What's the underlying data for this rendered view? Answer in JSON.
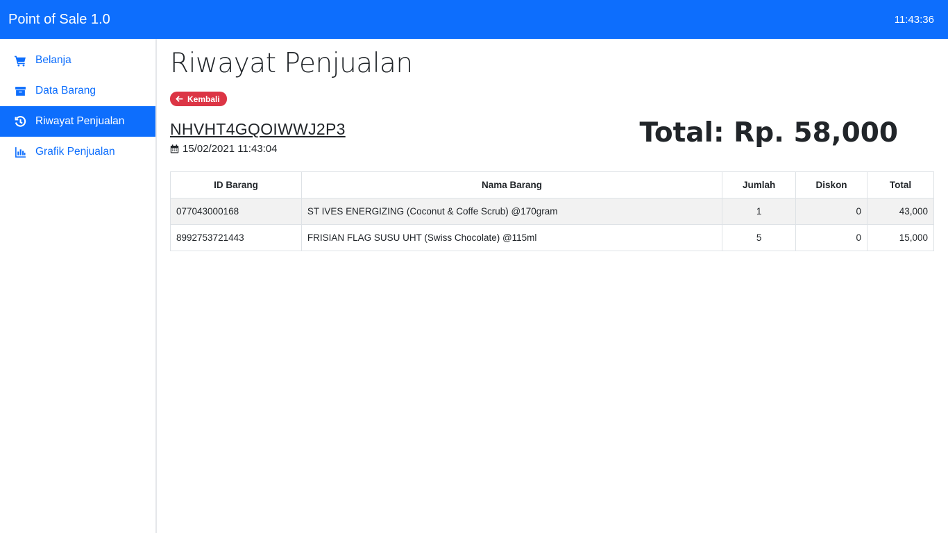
{
  "app": {
    "title": "Point of Sale 1.0",
    "clock": "11:43:36"
  },
  "sidebar": {
    "items": [
      {
        "label": "Belanja",
        "icon": "cart-icon",
        "active": false
      },
      {
        "label": "Data Barang",
        "icon": "archive-icon",
        "active": false
      },
      {
        "label": "Riwayat Penjualan",
        "icon": "history-icon",
        "active": true
      },
      {
        "label": "Grafik Penjualan",
        "icon": "bar-chart-icon",
        "active": false
      }
    ]
  },
  "page": {
    "title": "Riwayat Penjualan",
    "back_label": "Kembali",
    "transaction_id": "NHVHT4GQOIWWJ2P3",
    "date": "15/02/2021 11:43:04",
    "total": "Total: Rp. 58,000"
  },
  "table": {
    "headers": [
      "ID Barang",
      "Nama Barang",
      "Jumlah",
      "Diskon",
      "Total"
    ],
    "rows": [
      [
        "077043000168",
        "ST IVES ENERGIZING (Coconut & Coffe Scrub) @170gram",
        "1",
        "0",
        "43,000"
      ],
      [
        "8992753721443",
        "FRISIAN FLAG SUSU UHT (Swiss Chocolate) @115ml",
        "5",
        "0",
        "15,000"
      ]
    ]
  },
  "colors": {
    "primary": "#0d6efd",
    "danger": "#dc3545",
    "stripe": "#f2f2f2"
  }
}
